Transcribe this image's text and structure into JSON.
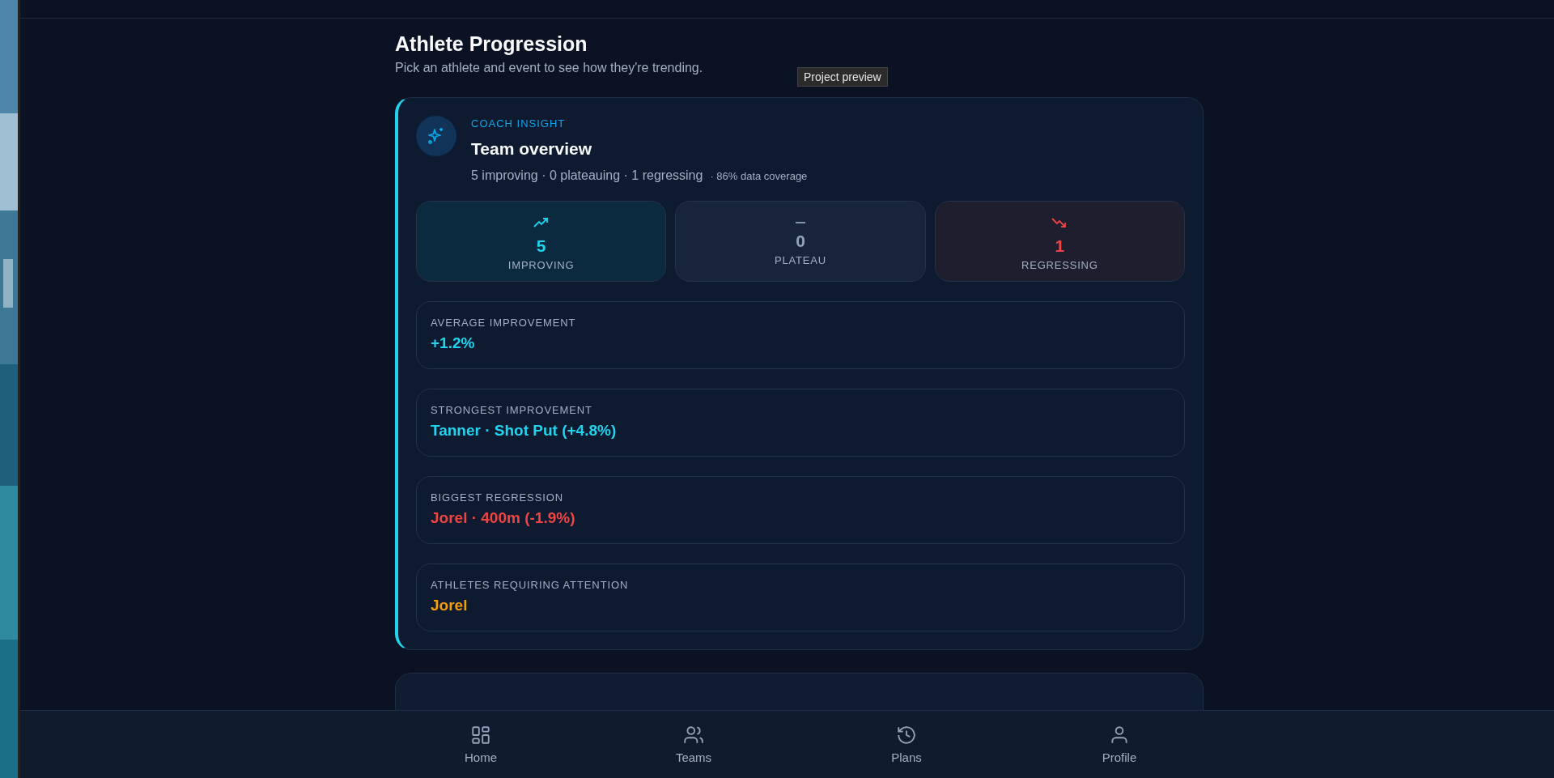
{
  "header": {
    "title": "Athlete Progression",
    "subtitle": "Pick an athlete and event to see how they're trending."
  },
  "tooltip": "Project preview",
  "insight": {
    "eyebrow": "COACH INSIGHT",
    "title": "Team overview",
    "summary": "5 improving · 0 plateauing · 1 regressing",
    "coverage": "· 86% data coverage",
    "stats": [
      {
        "kind": "improving",
        "value": "5",
        "label": "IMPROVING"
      },
      {
        "kind": "plateau",
        "value": "0",
        "label": "PLATEAU"
      },
      {
        "kind": "regressing",
        "value": "1",
        "label": "REGRESSING"
      }
    ],
    "metrics": [
      {
        "kind": "positive",
        "label": "AVERAGE IMPROVEMENT",
        "value": "+1.2%"
      },
      {
        "kind": "positive",
        "label": "STRONGEST IMPROVEMENT",
        "value": "Tanner · Shot Put (+4.8%)"
      },
      {
        "kind": "negative",
        "label": "BIGGEST REGRESSION",
        "value": "Jorel · 400m (-1.9%)"
      },
      {
        "kind": "warning",
        "label": "ATHLETES REQUIRING ATTENTION",
        "value": "Jorel"
      }
    ]
  },
  "nav": [
    {
      "kind": "home",
      "label": "Home"
    },
    {
      "kind": "teams",
      "label": "Teams"
    },
    {
      "kind": "plans",
      "label": "Plans"
    },
    {
      "kind": "profile",
      "label": "Profile"
    }
  ]
}
